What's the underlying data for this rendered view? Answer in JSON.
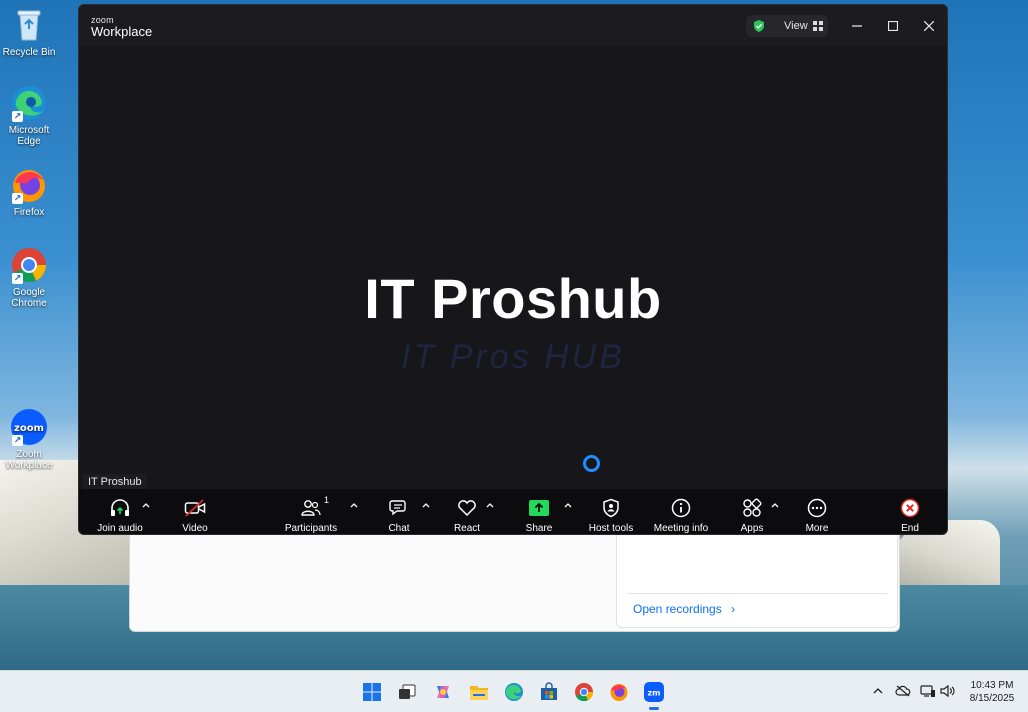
{
  "desktop": {
    "icons": [
      {
        "label": "Recycle Bin"
      },
      {
        "label": "Microsoft Edge"
      },
      {
        "label": "Firefox"
      },
      {
        "label": "Google Chrome"
      },
      {
        "label": "Zoom Workplace"
      }
    ]
  },
  "background_window": {
    "open_recordings_label": "Open recordings",
    "open_recordings_chevron": "›"
  },
  "zoom": {
    "brand_small": "zoom",
    "brand_big": "Workplace",
    "view_label": "View",
    "stage_title": "IT Proshub",
    "stage_watermark": "IT Pros HUB",
    "name_tag": "IT Proshub",
    "toolbar": {
      "join_audio": "Join audio",
      "video": "Video",
      "participants": "Participants",
      "participants_count": "1",
      "chat": "Chat",
      "react": "React",
      "share": "Share",
      "host_tools": "Host tools",
      "meeting_info": "Meeting info",
      "apps": "Apps",
      "more": "More",
      "end": "End"
    },
    "colors": {
      "share_green": "#23d959",
      "end_red": "#e02828",
      "shield_green": "#2bc55a",
      "spinner_blue": "#1e8fff"
    }
  },
  "taskbar": {
    "time": "10:43 PM",
    "date": "8/15/2025",
    "apps": [
      "start-icon",
      "task-view-icon",
      "copilot-icon",
      "file-explorer-icon",
      "edge-icon",
      "store-icon",
      "chrome-icon",
      "firefox-icon",
      "zoom-icon"
    ]
  }
}
